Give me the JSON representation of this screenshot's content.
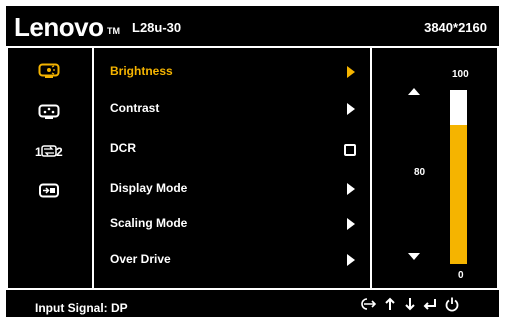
{
  "header": {
    "brand": "Lenovo",
    "trademark": "TM",
    "model": "L28u-30",
    "resolution": "3840*2160"
  },
  "sidebar": {
    "items": [
      {
        "icon": "picture-settings-icon",
        "active": true
      },
      {
        "icon": "image-properties-icon",
        "active": false
      },
      {
        "icon": "input-signal-icon",
        "label": "1⇄2",
        "active": false
      },
      {
        "icon": "advanced-settings-icon",
        "active": false
      }
    ]
  },
  "menu": {
    "items": [
      {
        "label": "Brightness",
        "control": "arrow",
        "selected": true
      },
      {
        "label": "Contrast",
        "control": "arrow",
        "selected": false
      },
      {
        "label": "DCR",
        "control": "checkbox",
        "selected": false
      },
      {
        "label": "Display Mode",
        "control": "arrow",
        "selected": false
      },
      {
        "label": "Scaling Mode",
        "control": "arrow",
        "selected": false
      },
      {
        "label": "Over Drive",
        "control": "arrow",
        "selected": false
      }
    ]
  },
  "gauge": {
    "max_label": "100",
    "min_label": "0",
    "current_label": "80",
    "value": 80,
    "max": 100
  },
  "footer": {
    "label": "Input Signal: DP",
    "icons": [
      "input-switch-icon",
      "up-arrow-icon",
      "down-arrow-icon",
      "enter-icon",
      "power-icon"
    ]
  },
  "colors": {
    "accent": "#f5b400",
    "background": "#000000",
    "foreground": "#ffffff"
  }
}
